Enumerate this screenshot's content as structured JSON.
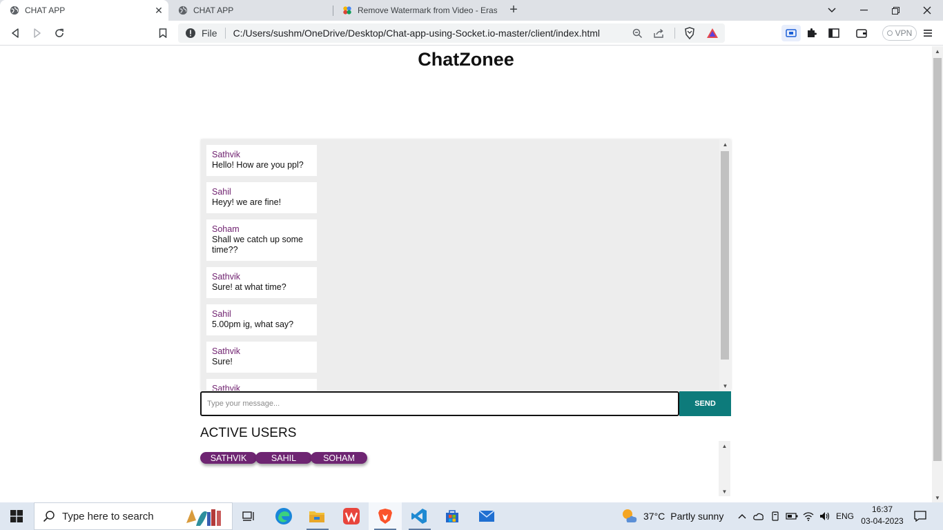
{
  "browser": {
    "tabs": [
      {
        "title": "CHAT APP",
        "active": true,
        "favicon": "globe-icon"
      },
      {
        "title": "CHAT APP",
        "active": false,
        "favicon": "globe-icon"
      },
      {
        "title": "Remove Watermark from Video - Eras",
        "active": false,
        "favicon": "colorful-app-icon"
      }
    ],
    "address": {
      "scheme": "File",
      "url": "C:/Users/sushm/OneDrive/Desktop/Chat-app-using-Socket.io-master/client/index.html"
    },
    "vpn_label": "VPN"
  },
  "page": {
    "title": "ChatZonee",
    "messages": [
      {
        "sender": "Sathvik",
        "text": "Hello! How are you ppl?"
      },
      {
        "sender": "Sahil",
        "text": "Heyy! we are fine!"
      },
      {
        "sender": "Soham",
        "text": "Shall we catch up some time??"
      },
      {
        "sender": "Sathvik",
        "text": "Sure! at what time?"
      },
      {
        "sender": "Sahil",
        "text": "5.00pm ig, what say?"
      },
      {
        "sender": "Sathvik",
        "text": "Sure!"
      },
      {
        "sender": "Sathvik",
        "text": ""
      }
    ],
    "input": {
      "placeholder": "Type your message...",
      "value": ""
    },
    "send_label": "SEND",
    "active_users_title": "ACTIVE USERS",
    "active_users": [
      "SATHVIK",
      "SAHIL",
      "SOHAM"
    ],
    "colors": {
      "accent": "#0d7b7b",
      "pill": "#6e2572",
      "sender": "#6e1f6e"
    }
  },
  "taskbar": {
    "search_placeholder": "Type here to search",
    "weather": {
      "temp": "37°C",
      "condition": "Partly sunny"
    },
    "language": "ENG",
    "time": "16:37",
    "date": "03-04-2023",
    "apps": [
      "task-view-icon",
      "edge-icon",
      "file-explorer-icon",
      "wps-icon",
      "brave-icon",
      "vscode-icon",
      "store-icon",
      "mail-icon"
    ]
  }
}
